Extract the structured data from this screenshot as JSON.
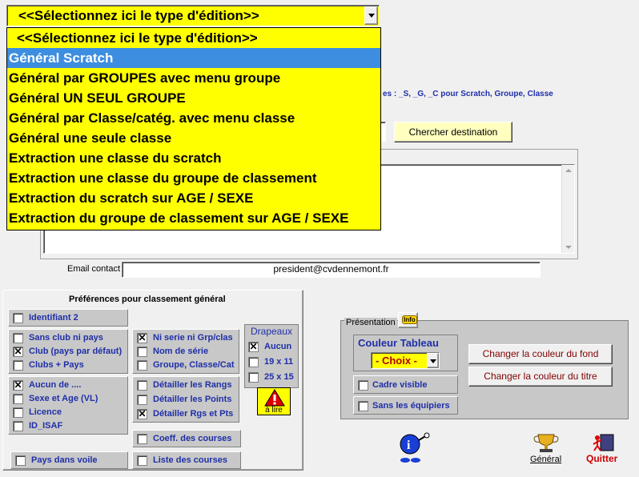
{
  "combo": {
    "value": "<<Sélectionnez ici le type d'édition>>"
  },
  "dropdown": {
    "items": [
      "<<Sélectionnez ici le type d'édition>>",
      "Général Scratch",
      "Général par GROUPES avec menu groupe",
      "Général UN SEUL GROUPE",
      "Général par Classe/catég. avec menu classe",
      "Général une seule classe",
      "Extraction une classe du scratch",
      "Extraction une classe du groupe de classement",
      "Extraction du scratch sur AGE / SEXE",
      "Extraction du groupe de classement sur AGE / SEXE"
    ],
    "selected_index": 1
  },
  "hint": {
    "text": "es  : _S, _G, _C pour Scratch, Groupe, Classe"
  },
  "chercher_button": "Chercher destination",
  "email": {
    "label": "Email contact",
    "value": "president@cvdennemont.fr"
  },
  "prefs": {
    "title": "Préférences pour classement général",
    "identifiant": "Identifiant 2",
    "club_group": [
      {
        "label": "Sans club ni pays",
        "checked": false
      },
      {
        "label": "Club (pays par défaut)",
        "checked": true
      },
      {
        "label": "Clubs + Pays",
        "checked": false
      }
    ],
    "serie_group": [
      {
        "label": "Ni serie ni Grp/clas",
        "checked": true
      },
      {
        "label": "Nom de série",
        "checked": false
      },
      {
        "label": "Groupe, Classe/Cat",
        "checked": false
      }
    ],
    "aucun_group": [
      {
        "label": "Aucun de ....",
        "checked": true
      },
      {
        "label": "Sexe et Age (VL)",
        "checked": false
      },
      {
        "label": "Licence",
        "checked": false
      },
      {
        "label": "ID_ISAF",
        "checked": false
      }
    ],
    "detail_group": [
      {
        "label": "Détailler les Rangs",
        "checked": false
      },
      {
        "label": "Détailler les Points",
        "checked": false
      },
      {
        "label": "Détailler Rgs et Pts",
        "checked": true
      }
    ],
    "coeff": "Coeff. des courses",
    "liste": "Liste des courses",
    "pays_voile": "Pays dans voile",
    "drapeaux": {
      "title": "Drapeaux",
      "options": [
        {
          "label": "Aucun",
          "checked": true
        },
        {
          "label": "19 x 11",
          "checked": false
        },
        {
          "label": "25 x 15",
          "checked": false
        }
      ],
      "alire": "à lire"
    }
  },
  "presentation": {
    "title": "Présentation",
    "couleur_label": "Couleur Tableau",
    "choix": "- Choix -",
    "btn_fond": "Changer la couleur du fond",
    "btn_titre": "Changer la couleur du titre",
    "cadre": "Cadre visible",
    "equipiers": "Sans les équipiers"
  },
  "bottom": {
    "general": "Général",
    "quitter": "Quitter"
  },
  "colors": {
    "dropdown_bg": "#ffff00",
    "selected": "#3d8ee0",
    "label_blue": "#1f2fa8",
    "quitter_red": "#cc0000"
  }
}
